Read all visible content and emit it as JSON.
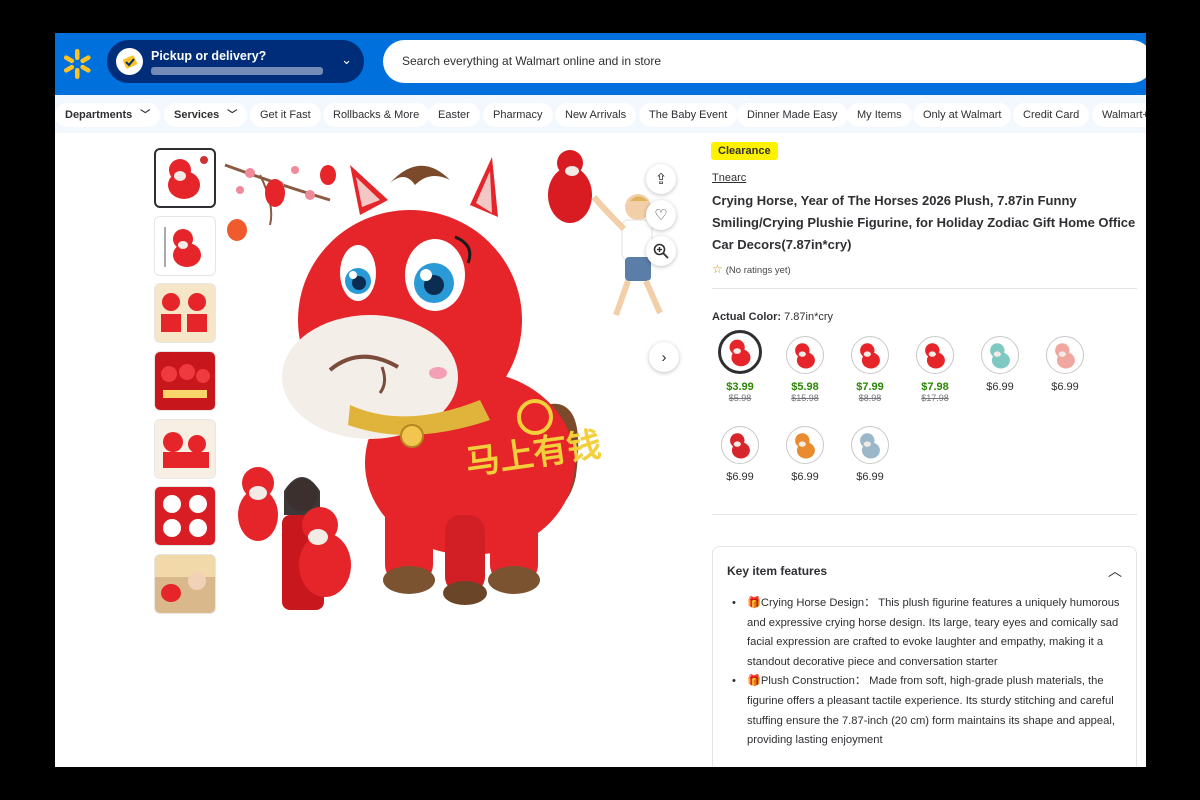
{
  "header": {
    "pickup_title": "Pickup or delivery?",
    "search_placeholder": "Search everything at Walmart online and in store"
  },
  "nav": {
    "departments": "Departments",
    "services": "Services",
    "items": [
      "Get it Fast",
      "Rollbacks & More",
      "Easter",
      "Pharmacy",
      "New Arrivals",
      "The Baby Event",
      "Dinner Made Easy",
      "My Items",
      "Only at Walmart",
      "Credit Card",
      "Walmart+"
    ]
  },
  "product": {
    "badge": "Clearance",
    "brand": "Tnearc",
    "title": "Crying Horse, Year of The Horses 2026 Plush, 7.87in Funny Smiling/Crying Plushie Figurine, for Holiday Zodiac Gift Home Office Car Decors(7.87in*cry)",
    "ratings": "(No ratings yet)",
    "color_label": "Actual Color:",
    "color_value": "7.87in*cry",
    "plush_text": "马上有钱",
    "swatches": [
      {
        "price": "$3.99",
        "was": "$5.98",
        "sale": true,
        "color": "#e5252a"
      },
      {
        "price": "$5.98",
        "was": "$15.98",
        "sale": true,
        "color": "#e5252a"
      },
      {
        "price": "$7.99",
        "was": "$8.98",
        "sale": true,
        "color": "#e5252a"
      },
      {
        "price": "$7.98",
        "was": "$17.98",
        "sale": true,
        "color": "#e5252a"
      },
      {
        "price": "$6.99",
        "was": "",
        "sale": false,
        "color": "#7fc9c3"
      },
      {
        "price": "$6.99",
        "was": "",
        "sale": false,
        "color": "#f0a7a0"
      },
      {
        "price": "$6.99",
        "was": "",
        "sale": false,
        "color": "#d7262b"
      },
      {
        "price": "$6.99",
        "was": "",
        "sale": false,
        "color": "#e98b2e"
      },
      {
        "price": "$6.99",
        "was": "",
        "sale": false,
        "color": "#9bb7c9"
      }
    ]
  },
  "features": {
    "heading": "Key item features",
    "items": [
      "🎁Crying Horse Design： This plush figurine features a uniquely humorous and expressive crying horse design. Its large, teary eyes and comically sad facial expression are crafted to evoke laughter and empathy, making it a standout decorative piece and conversation starter",
      "🎁Plush Construction： Made from soft, high-grade plush materials, the figurine offers a pleasant tactile experience. Its sturdy stitching and careful stuffing ensure the 7.87-inch (20 cm) form maintains its shape and appeal, providing lasting enjoyment"
    ]
  },
  "colors": {
    "walmart_blue": "#0071dc",
    "dark_blue": "#002d7a",
    "spark_yellow": "#ffc220",
    "clearance_yellow": "#fff200",
    "sale_green": "#2a8703",
    "plush_red": "#e5252a"
  }
}
